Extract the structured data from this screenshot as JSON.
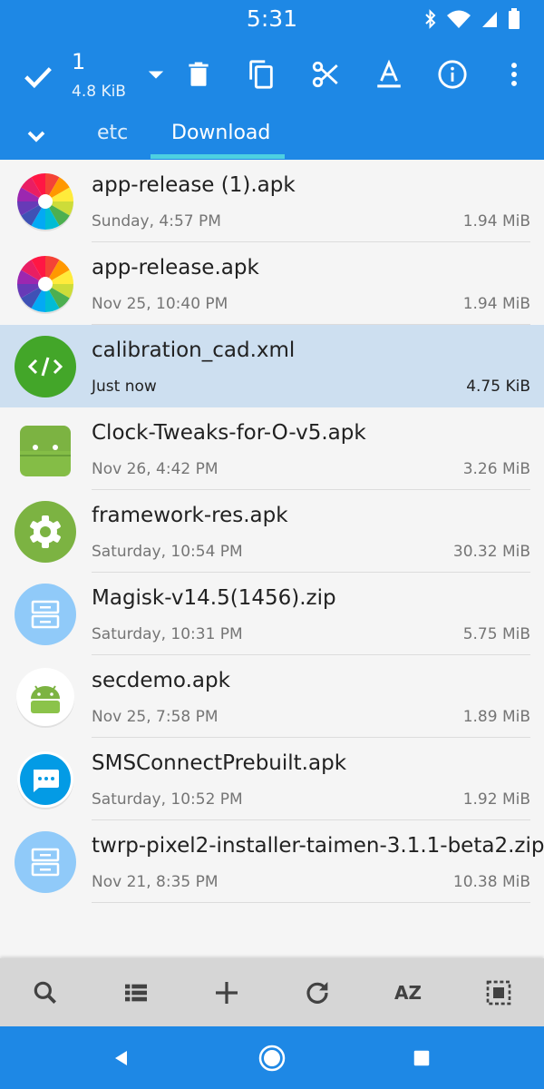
{
  "status_bar": {
    "time": "5:31",
    "icons": [
      "bluetooth-icon",
      "wifi-icon",
      "cell-signal-icon",
      "battery-icon"
    ]
  },
  "toolbar": {
    "selected_count": "1",
    "selected_size": "4.8 KiB",
    "actions": [
      "check-icon",
      "dropdown-icon",
      "delete-icon",
      "copy-icon",
      "cut-icon",
      "rename-icon",
      "info-icon",
      "more-vert-icon"
    ]
  },
  "tabs": {
    "items": [
      "etc",
      "Download"
    ],
    "active": "Download"
  },
  "files": [
    {
      "name": "app-release (1).apk",
      "date": "Sunday, 4:57 PM",
      "size": "1.94 MiB",
      "icon": "color-wheel-app-icon",
      "selected": false
    },
    {
      "name": "app-release.apk",
      "date": "Nov 25, 10:40 PM",
      "size": "1.94 MiB",
      "icon": "color-wheel-app-icon",
      "selected": false
    },
    {
      "name": "calibration_cad.xml",
      "date": "Just now",
      "size": "4.75 KiB",
      "icon": "code-file-icon",
      "selected": true
    },
    {
      "name": "Clock-Tweaks-for-O-v5.apk",
      "date": "Nov 26, 4:42 PM",
      "size": "3.26 MiB",
      "icon": "android-icon",
      "selected": false
    },
    {
      "name": "framework-res.apk",
      "date": "Saturday, 10:54 PM",
      "size": "30.32 MiB",
      "icon": "settings-gear-app-icon",
      "selected": false
    },
    {
      "name": "Magisk-v14.5(1456).zip",
      "date": "Saturday, 10:31 PM",
      "size": "5.75 MiB",
      "icon": "archive-icon",
      "selected": false
    },
    {
      "name": "secdemo.apk",
      "date": "Nov 25, 7:58 PM",
      "size": "1.89 MiB",
      "icon": "android-round-icon",
      "selected": false
    },
    {
      "name": "SMSConnectPrebuilt.apk",
      "date": "Saturday, 10:52 PM",
      "size": "1.92 MiB",
      "icon": "messages-app-icon",
      "selected": false
    },
    {
      "name": "twrp-pixel2-installer-taimen-3.1.1-beta2.zip",
      "date": "Nov 21, 8:35 PM",
      "size": "10.38 MiB",
      "icon": "archive-icon",
      "selected": false
    }
  ],
  "bottom_bar": {
    "sort_label": "AZ",
    "actions": [
      "search-icon",
      "list-view-icon",
      "add-icon",
      "refresh-icon",
      "sort-icon",
      "select-all-icon"
    ]
  },
  "nav_bar": {
    "buttons": [
      "back-icon",
      "home-icon",
      "recents-icon"
    ]
  },
  "colors": {
    "primary": "#1e88e5",
    "accent": "#4dd0e1",
    "selected_row": "#cddff0",
    "bottom_bar": "#d6d6d6"
  }
}
